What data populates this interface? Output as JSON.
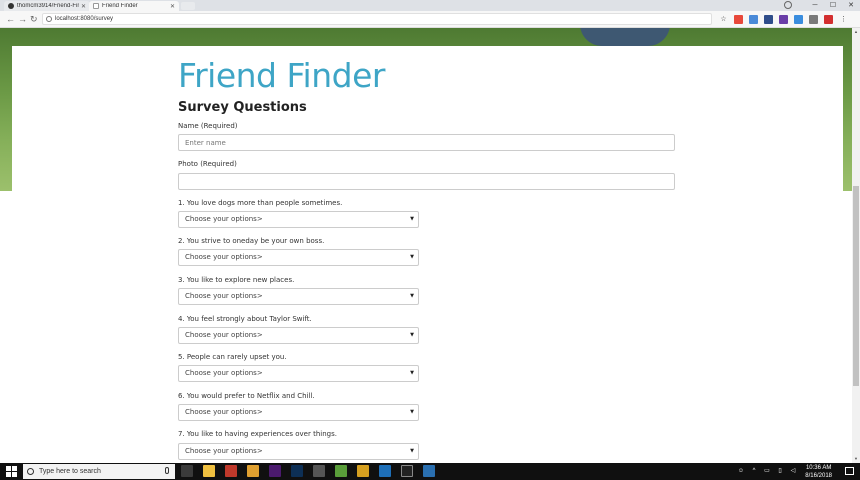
{
  "browser": {
    "tabs": [
      {
        "title": "thomcm3914/Friend-Fin",
        "active": false
      },
      {
        "title": "Friend Finder",
        "active": true
      }
    ],
    "url": "localhost:8080/survey",
    "window_controls": {
      "minimize": "─",
      "maximize": "☐",
      "close": "✕"
    },
    "nav": {
      "back": "←",
      "forward": "→",
      "reload": "↻"
    }
  },
  "page": {
    "title": "Friend Finder",
    "section_heading": "Survey Questions",
    "name_field": {
      "label": "Name (Required)",
      "placeholder": "Enter name"
    },
    "photo_field": {
      "label": "Photo (Required)",
      "placeholder": ""
    },
    "questions": [
      {
        "label": "1. You love dogs more than people sometimes.",
        "selected": "Choose your options>"
      },
      {
        "label": "2. You strive to oneday be your own boss.",
        "selected": "Choose your options>"
      },
      {
        "label": "3. You like to explore new places.",
        "selected": "Choose your options>"
      },
      {
        "label": "4. You feel strongly about Taylor Swift.",
        "selected": "Choose your options>"
      },
      {
        "label": "5. People can rarely upset you.",
        "selected": "Choose your options>"
      },
      {
        "label": "6. You would prefer to Netflix and Chill.",
        "selected": "Choose your options>"
      },
      {
        "label": "7. You like to having experiences over things.",
        "selected": "Choose your options>"
      }
    ]
  },
  "taskbar": {
    "search_placeholder": "Type here to search",
    "time": "10:36 AM",
    "date": "8/16/2018"
  },
  "colors": {
    "title": "#3ea5c6",
    "hero_green": "#6c9a46",
    "taskbar": "#101010"
  }
}
